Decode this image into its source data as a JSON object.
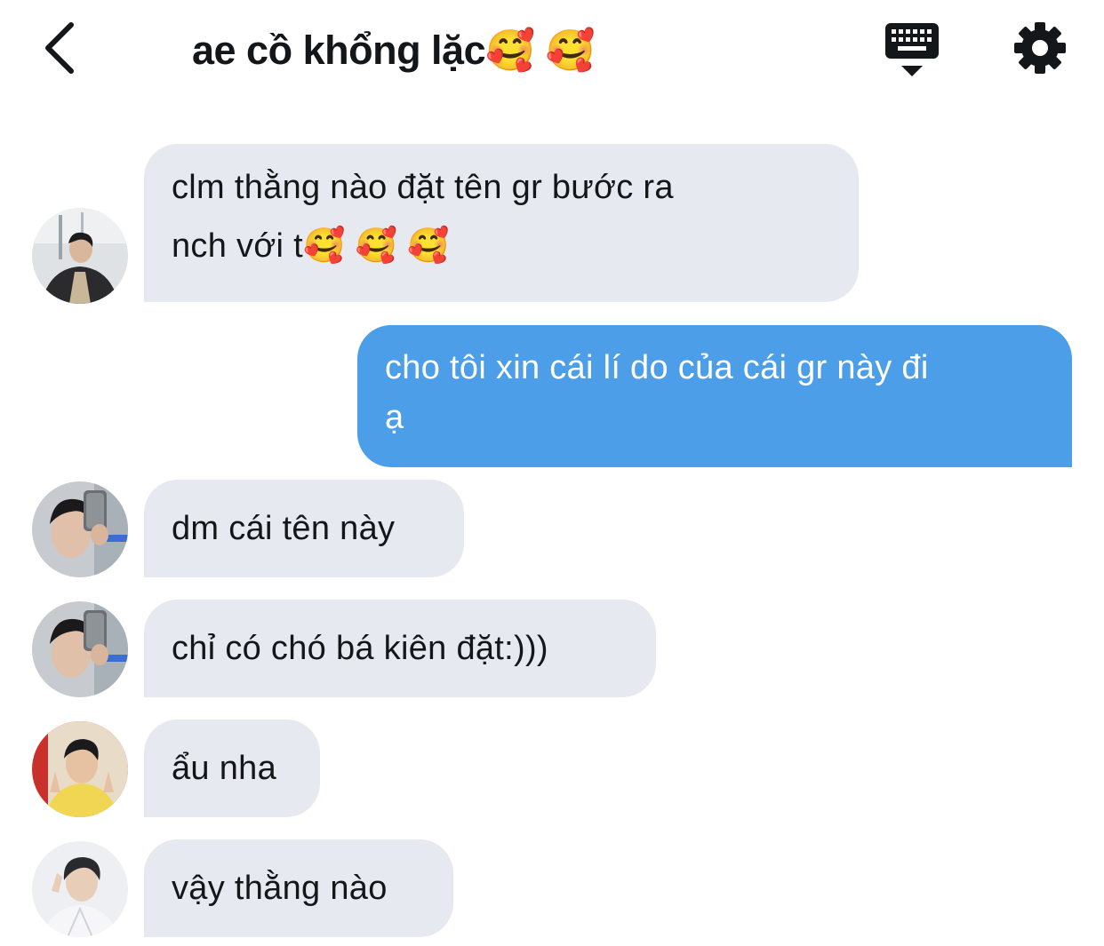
{
  "header": {
    "title": "ae cồ khổng lặc🥰 🥰",
    "back_icon": "chevron-left-icon",
    "keyboard_icon": "keyboard-icon",
    "settings_icon": "gear-icon"
  },
  "messages": [
    {
      "sender": "other",
      "avatar": "avatar-1",
      "lines": [
        "clm thằng nào đặt tên gr bước ra",
        "nch với t🥰 🥰 🥰"
      ]
    },
    {
      "sender": "me",
      "lines": [
        "cho tôi xin cái lí do của cái gr này đi",
        "ạ"
      ]
    },
    {
      "sender": "other",
      "avatar": "avatar-2",
      "lines": [
        "dm cái tên này"
      ]
    },
    {
      "sender": "other",
      "avatar": "avatar-2",
      "lines": [
        "chỉ có chó bá kiên đặt:)))"
      ]
    },
    {
      "sender": "other",
      "avatar": "avatar-3",
      "lines": [
        "ẩu nha"
      ]
    },
    {
      "sender": "other",
      "avatar": "avatar-4",
      "lines": [
        "vậy thằng nào"
      ]
    }
  ],
  "colors": {
    "incoming_bubble": "#e6e9ef",
    "outgoing_bubble": "#4d9ee8",
    "text": "#14171a"
  }
}
